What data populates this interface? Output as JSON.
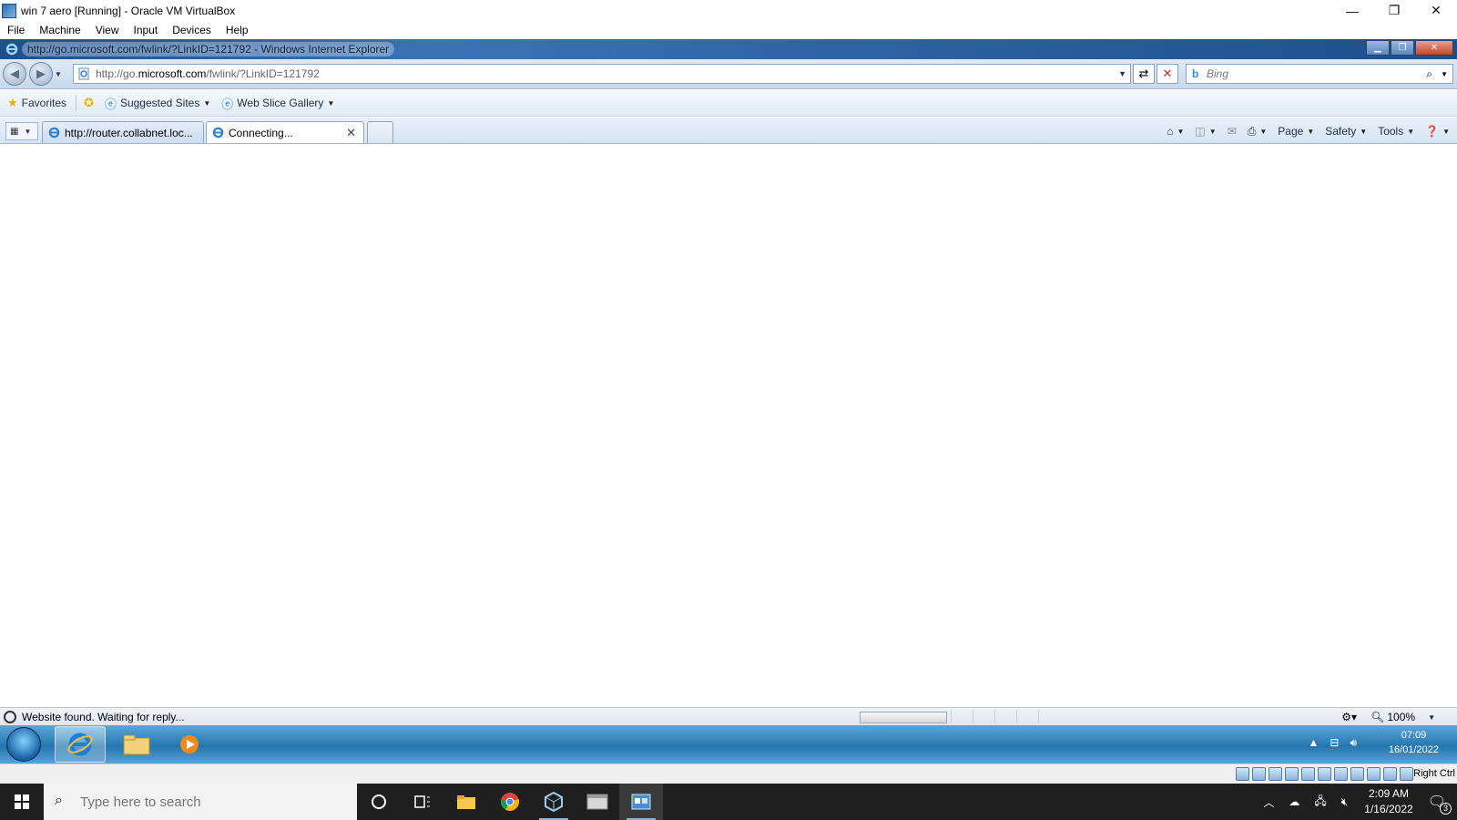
{
  "vbox": {
    "title": "win 7 aero [Running] - Oracle VM VirtualBox",
    "menu": [
      "File",
      "Machine",
      "View",
      "Input",
      "Devices",
      "Help"
    ],
    "controls": {
      "minimize": "—",
      "restore": "❐",
      "close": "✕"
    },
    "host_key": "Right Ctrl"
  },
  "ie": {
    "title": "http://go.microsoft.com/fwlink/?LinkID=121792 - Windows Internet Explorer",
    "address": {
      "prefix": "http://go.",
      "domain": "microsoft.com",
      "suffix": "/fwlink/?LinkID=121792"
    },
    "search_placeholder": "Bing",
    "favorites": {
      "favorites_label": "Favorites",
      "suggested_sites": "Suggested Sites",
      "web_slice_gallery": "Web Slice Gallery"
    },
    "tabs": [
      {
        "label": "http://router.collabnet.loc..."
      },
      {
        "label": "Connecting..."
      }
    ],
    "command_bar": {
      "page": "Page",
      "safety": "Safety",
      "tools": "Tools"
    },
    "status_text": "Website found. Waiting for reply...",
    "zoom": "100%"
  },
  "win7_taskbar": {
    "time": "07:09",
    "date": "16/01/2022"
  },
  "host_taskbar": {
    "search_placeholder": "Type here to search",
    "time": "2:09 AM",
    "date": "1/16/2022",
    "notifications": "3"
  },
  "colors": {
    "ie_titlebar": "#2d62a4",
    "win7_taskbar": "#2f7fb8",
    "host_taskbar": "#1f1f1f"
  }
}
